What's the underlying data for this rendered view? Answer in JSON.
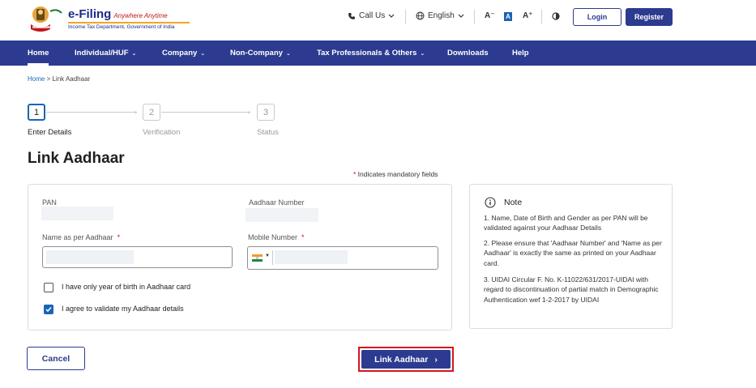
{
  "header": {
    "logo_title": "e-Filing",
    "logo_tagline": "Anywhere Anytime",
    "logo_subtitle": "Income Tax Department, Government of India",
    "call_us": "Call Us",
    "language": "English",
    "font_decrease": "A⁻",
    "font_normal": "A",
    "font_increase": "A⁺",
    "login": "Login",
    "register": "Register"
  },
  "nav": {
    "items": [
      {
        "label": "Home",
        "caret": ""
      },
      {
        "label": "Individual/HUF",
        "caret": "⌄"
      },
      {
        "label": "Company",
        "caret": "⌄"
      },
      {
        "label": "Non-Company",
        "caret": "⌄"
      },
      {
        "label": "Tax Professionals & Others",
        "caret": "⌄"
      },
      {
        "label": "Downloads",
        "caret": ""
      },
      {
        "label": "Help",
        "caret": ""
      }
    ]
  },
  "breadcrumb": {
    "home": "Home",
    "separator": ">",
    "current": "Link Aadhaar"
  },
  "stepper": {
    "steps": [
      {
        "number": "1",
        "label": "Enter Details"
      },
      {
        "number": "2",
        "label": "Verification"
      },
      {
        "number": "3",
        "label": "Status"
      }
    ]
  },
  "page": {
    "title": "Link Aadhaar",
    "mandatory_star": "*",
    "mandatory_note": " Indicates mandatory fields"
  },
  "form": {
    "pan_label": "PAN",
    "aadhaar_label": "Aadhaar Number",
    "name_label": "Name as per Aadhaar",
    "mobile_label": "Mobile Number",
    "required_mark": "*",
    "checkbox_year": "I have only year of birth in Aadhaar card",
    "checkbox_agree": "I agree to validate my Aadhaar details"
  },
  "note": {
    "title": "Note",
    "items": [
      "1. Name, Date of Birth and Gender as per PAN will be validated against your Aadhaar Details",
      "2. Please ensure that 'Aadhaar Number' and 'Name as per Aadhaar' is exactly the same as printed on your Aadhaar card.",
      "3. UIDAI Circular F. No. K-11022/631/2017-UIDAI with regard to discontinuation of partial match in Demographic Authentication wef 1-2-2017 by UIDAI"
    ]
  },
  "actions": {
    "cancel": "Cancel",
    "submit": "Link Aadhaar",
    "submit_arrow": "›"
  },
  "colors": {
    "brand_navy": "#2c3b8f",
    "link_blue": "#1a64b8",
    "required_red": "#c4151c",
    "highlight_red": "#d7141b"
  }
}
